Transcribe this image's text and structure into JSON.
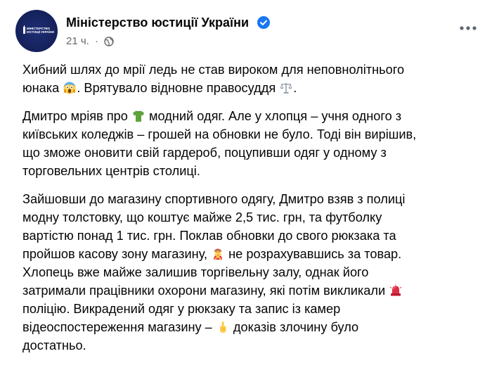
{
  "post": {
    "author": "Міністерство юстиції України",
    "avatar_text": "Міністерство юстиції України",
    "time": "21 ч.",
    "separator": "·",
    "verified_icon": "verified-badge-icon",
    "privacy_icon": "globe-icon",
    "more_icon": "more-options-icon",
    "colors": {
      "avatar_bg": "#1a2766",
      "verified": "#1877f2",
      "meta_text": "#65676b",
      "body_text": "#050505"
    }
  },
  "body": {
    "p1": {
      "line1": "Хибний шлях до мрії ледь не став вироком для неповнолітнього",
      "line2a": "юнака ",
      "line2b": ". Врятувало відновне правосуддя ",
      "line2c": ".",
      "emojis": [
        "screaming-face-emoji",
        "balance-scale-emoji"
      ]
    },
    "p2": {
      "line1a": "Дмитро мріяв про ",
      "line1b": " модний одяг. Але у хлопця – учня одного з",
      "line2": "київських коледжів – грошей на обновки не було. Тоді він вирішив,",
      "line3": "що зможе оновити свій гардероб, поцупивши одяг у одному з",
      "line4": "торговельних центрів столиці.",
      "emojis": [
        "tshirt-emoji"
      ]
    },
    "p3": {
      "line1": "Зайшовши до магазину спортивного одягу, Дмитро взяв з полиці",
      "line2": "модну толстовку, що коштує майже 2,5 тис. грн, та футболку",
      "line3": "вартістю понад 1 тис. грн. Поклав обновки до свого рюкзака та",
      "line4a": "пройшов касову зону магазину, ",
      "line4b": " не розрахувавшись за товар.",
      "line5": "Хлопець вже майже залишив торгівельну залу, однак його",
      "line6a": "затримали працівники охорони магазину, які потім викликали ",
      "line7": "поліцію. Викрадений одяг у рюкзаку та запис із камер",
      "line8a": "відеоспостереження магазину – ",
      "line8b": " доказів злочину було",
      "line9": "достатньо.",
      "emojis": [
        "person-gesturing-no-emoji",
        "police-light-emoji",
        "pointing-finger-emoji"
      ]
    }
  }
}
